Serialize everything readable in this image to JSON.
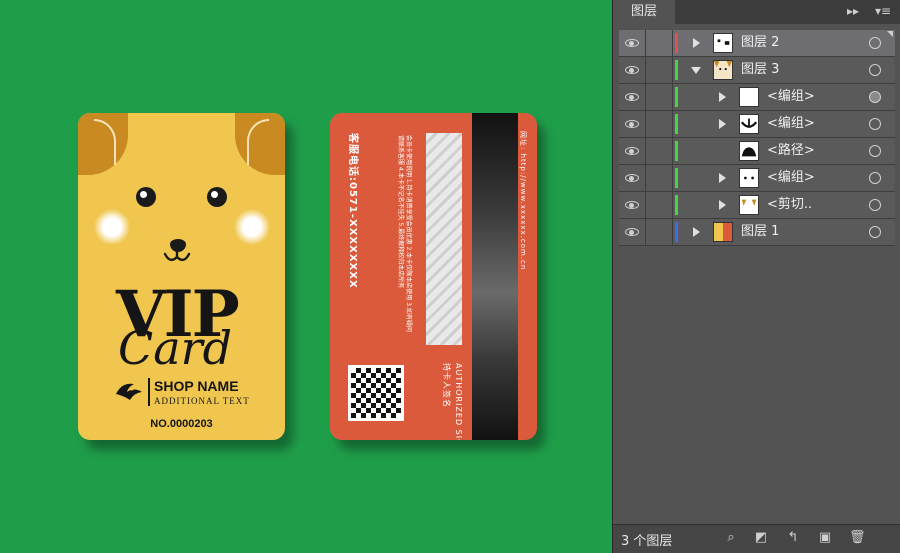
{
  "front_card": {
    "title": "VIP",
    "subtitle": "Card",
    "shop_name": "SHOP NAME",
    "additional_text": "ADDITIONAL TEXT",
    "card_number": "NO.0000203"
  },
  "back_card": {
    "hotline": "客服电话:0571-XXXXXXXX",
    "rules": "会员卡使用说明 1.持卡消费享受会员优惠 2.本卡仅限本店使用 3.如有疑问请联系客服 4.本卡不记名不挂失 5.最终解释权归本店所有",
    "authorized_en": "AUTHORIZED SIGNATURE",
    "authorized_cn": "持卡人签名",
    "url": "网址: http://www.xxxxxx.com.cn"
  },
  "layers_panel": {
    "tab_label": "图层",
    "menu_icon": "panel-menu-icon",
    "collapse_icon": "double-chevron-icon",
    "layers": [
      {
        "name": "图层 2",
        "color": "#e0504a",
        "expand": "right",
        "indent": 0,
        "thumb": "layer2",
        "selected": true,
        "target_filled": false
      },
      {
        "name": "图层 3",
        "color": "#4ad24a",
        "expand": "down",
        "indent": 0,
        "thumb": "layer3",
        "selected": false,
        "target_filled": false
      },
      {
        "name": "<编组>",
        "color": "#4ad24a",
        "expand": "right",
        "indent": 1,
        "thumb": "blank",
        "selected": false,
        "target_filled": true
      },
      {
        "name": "<编组>",
        "color": "#4ad24a",
        "expand": "right",
        "indent": 1,
        "thumb": "mouth",
        "selected": false,
        "target_filled": false
      },
      {
        "name": "<路径>",
        "color": "#4ad24a",
        "expand": "none",
        "indent": 1,
        "thumb": "path",
        "selected": false,
        "target_filled": false
      },
      {
        "name": "<编组>",
        "color": "#4ad24a",
        "expand": "right",
        "indent": 1,
        "thumb": "eyes",
        "selected": false,
        "target_filled": false
      },
      {
        "name": "<剪切..",
        "color": "#4ad24a",
        "expand": "right",
        "indent": 1,
        "thumb": "clip",
        "selected": false,
        "target_filled": false
      },
      {
        "name": "图层 1",
        "color": "#3a6cf0",
        "expand": "right",
        "indent": 0,
        "thumb": "layer1",
        "selected": false,
        "target_filled": false
      }
    ],
    "footer": {
      "count_text": "3 个图层",
      "icons": [
        "locate-icon",
        "make-clipping-mask-icon",
        "new-sublayer-icon",
        "new-layer-icon",
        "delete-icon"
      ]
    }
  }
}
